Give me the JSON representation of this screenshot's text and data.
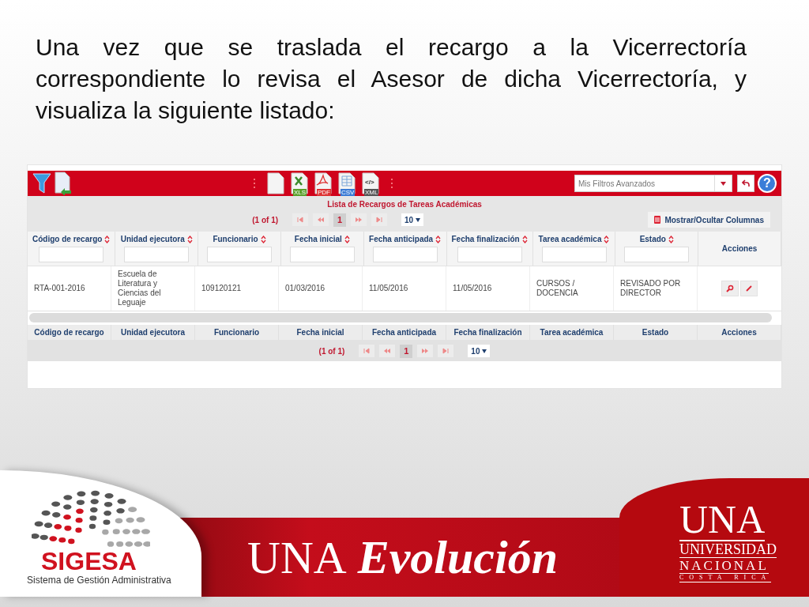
{
  "heading": "Una vez que se traslada el recargo a la Vicerrectoría correspondiente lo revisa el Asesor de dicha Vicerrectoría, y visualiza la siguiente listado:",
  "app": {
    "toolbar": {
      "export_buttons": [
        {
          "kind": "blank"
        },
        {
          "kind": "xls",
          "tag": "XLS"
        },
        {
          "kind": "pdf",
          "tag": "PDF"
        },
        {
          "kind": "csv",
          "tag": "CSV"
        },
        {
          "kind": "xml",
          "tag": "XML",
          "glyph": "</>"
        }
      ],
      "filter_select": {
        "placeholder": "Mis Filtros Avanzados"
      },
      "help_label": "?"
    },
    "table_title": "Lista de Recargos de Tareas Académicas",
    "paginator_top": {
      "page_report": "(1 of 1)",
      "pages": [
        {
          "label": "1",
          "selected": true
        }
      ],
      "rows_per_page": "10"
    },
    "toggle_columns_button": "Mostrar/Ocultar Columnas",
    "columns": [
      {
        "label": "Código de recargo",
        "sortable": true,
        "filter": true
      },
      {
        "label": "Unidad ejecutora",
        "sortable": true,
        "filter": true
      },
      {
        "label": "Funcionario",
        "sortable": true,
        "filter": true
      },
      {
        "label": "Fecha inicial",
        "sortable": true,
        "filter": true
      },
      {
        "label": "Fecha anticipada",
        "sortable": true,
        "filter": true
      },
      {
        "label": "Fecha finalización",
        "sortable": true,
        "filter": true
      },
      {
        "label": "Tarea académica",
        "sortable": true,
        "filter": true
      },
      {
        "label": "Estado",
        "sortable": true,
        "filter": true
      },
      {
        "label": "Acciones",
        "sortable": false,
        "filter": false
      }
    ],
    "rows": [
      {
        "cells": [
          "RTA-001-2016",
          "Escuela de Literatura y Ciencias del Leguaje",
          "109120121",
          "01/03/2016",
          "11/05/2016",
          "11/05/2016",
          "CURSOS / DOCENCIA",
          "REVISADO POR DIRECTOR"
        ]
      }
    ],
    "footer_columns": [
      "Código de recargo",
      "Unidad ejecutora",
      "Funcionario",
      "Fecha inicial",
      "Fecha anticipada",
      "Fecha finalización",
      "Tarea académica",
      "Estado",
      "Acciones"
    ],
    "paginator_bottom": {
      "page_report": "(1 of 1)",
      "pages": [
        {
          "label": "1",
          "selected": true
        }
      ],
      "rows_per_page": "10"
    }
  },
  "footer": {
    "sigesa": {
      "name": "SIGESA",
      "subtitle": "Sistema de Gestión Administrativa"
    },
    "banner": {
      "una": "UNA",
      "word": "Evolución"
    },
    "university": {
      "una": "UNA",
      "line_1": "UNIVERSIDAD",
      "line_2": "NACIONAL",
      "line_3": "COSTA RICA"
    }
  }
}
